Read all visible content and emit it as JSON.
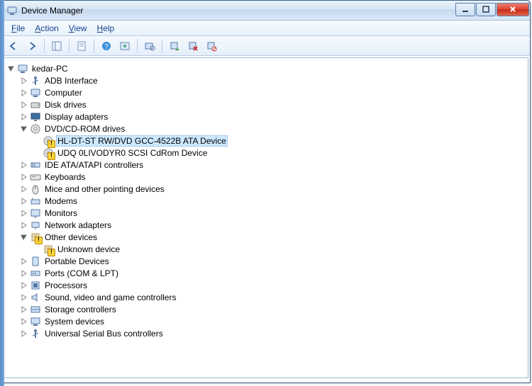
{
  "window": {
    "title": "Device Manager"
  },
  "menu": {
    "file": "File",
    "action": "Action",
    "view": "View",
    "help": "Help"
  },
  "root": {
    "name": "kedar-PC"
  },
  "categories": [
    {
      "label": "ADB Interface",
      "icon": "usb",
      "expanded": false
    },
    {
      "label": "Computer",
      "icon": "computer",
      "expanded": false
    },
    {
      "label": "Disk drives",
      "icon": "disk",
      "expanded": false
    },
    {
      "label": "Display adapters",
      "icon": "display",
      "expanded": false
    },
    {
      "label": "DVD/CD-ROM drives",
      "icon": "optical",
      "expanded": true,
      "children": [
        {
          "label": "HL-DT-ST RW/DVD GCC-4522B ATA Device",
          "warning": true,
          "selected": true
        },
        {
          "label": "UDQ 0LIVODYR0 SCSI CdRom Device",
          "warning": true
        }
      ]
    },
    {
      "label": "IDE ATA/ATAPI controllers",
      "icon": "ide",
      "expanded": false
    },
    {
      "label": "Keyboards",
      "icon": "keyboard",
      "expanded": false
    },
    {
      "label": "Mice and other pointing devices",
      "icon": "mouse",
      "expanded": false
    },
    {
      "label": "Modems",
      "icon": "modem",
      "expanded": false
    },
    {
      "label": "Monitors",
      "icon": "monitor",
      "expanded": false
    },
    {
      "label": "Network adapters",
      "icon": "network",
      "expanded": false
    },
    {
      "label": "Other devices",
      "icon": "other",
      "expanded": true,
      "warning": true,
      "children": [
        {
          "label": "Unknown device",
          "warning": true
        }
      ]
    },
    {
      "label": "Portable Devices",
      "icon": "portable",
      "expanded": false
    },
    {
      "label": "Ports (COM & LPT)",
      "icon": "port",
      "expanded": false
    },
    {
      "label": "Processors",
      "icon": "cpu",
      "expanded": false
    },
    {
      "label": "Sound, video and game controllers",
      "icon": "sound",
      "expanded": false
    },
    {
      "label": "Storage controllers",
      "icon": "storage",
      "expanded": false
    },
    {
      "label": "System devices",
      "icon": "system",
      "expanded": false
    },
    {
      "label": "Universal Serial Bus controllers",
      "icon": "usb",
      "expanded": false
    }
  ]
}
